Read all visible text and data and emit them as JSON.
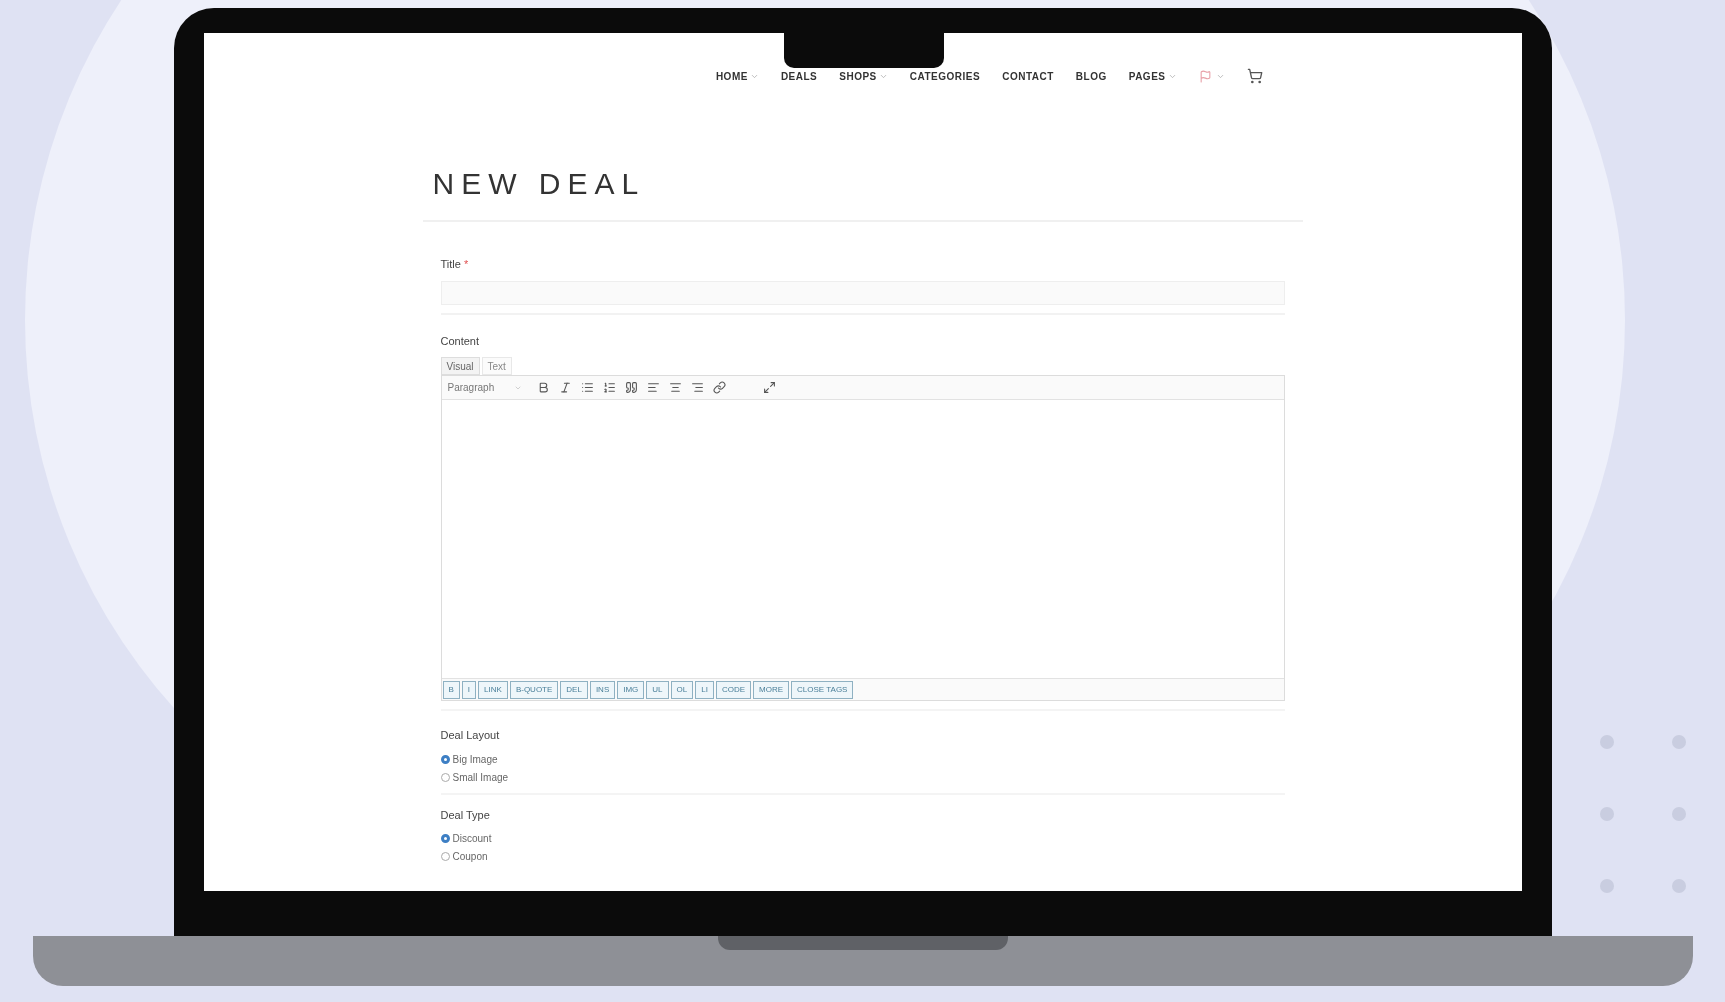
{
  "nav": {
    "items": [
      {
        "label": "HOME",
        "dropdown": true
      },
      {
        "label": "DEALS",
        "dropdown": false
      },
      {
        "label": "SHOPS",
        "dropdown": true
      },
      {
        "label": "CATEGORIES",
        "dropdown": false
      },
      {
        "label": "CONTACT",
        "dropdown": false
      },
      {
        "label": "BLOG",
        "dropdown": false
      },
      {
        "label": "PAGES",
        "dropdown": true
      }
    ]
  },
  "heading": "NEW DEAL",
  "title_field": {
    "label": "Title",
    "required": "*"
  },
  "content": {
    "label": "Content",
    "tabs": [
      {
        "label": "Visual",
        "selected": true
      },
      {
        "label": "Text",
        "selected": false
      }
    ],
    "format_select": "Paragraph",
    "quicktags": [
      "B",
      "I",
      "LINK",
      "B-QUOTE",
      "DEL",
      "INS",
      "IMG",
      "UL",
      "OL",
      "LI",
      "CODE",
      "MORE",
      "CLOSE TAGS"
    ]
  },
  "radio_groups": [
    {
      "label": "Deal Layout",
      "options": [
        {
          "label": "Big Image",
          "selected": true
        },
        {
          "label": "Small Image",
          "selected": false
        }
      ]
    },
    {
      "label": "Deal Type",
      "options": [
        {
          "label": "Discount",
          "selected": true
        },
        {
          "label": "Coupon",
          "selected": false
        }
      ]
    }
  ]
}
